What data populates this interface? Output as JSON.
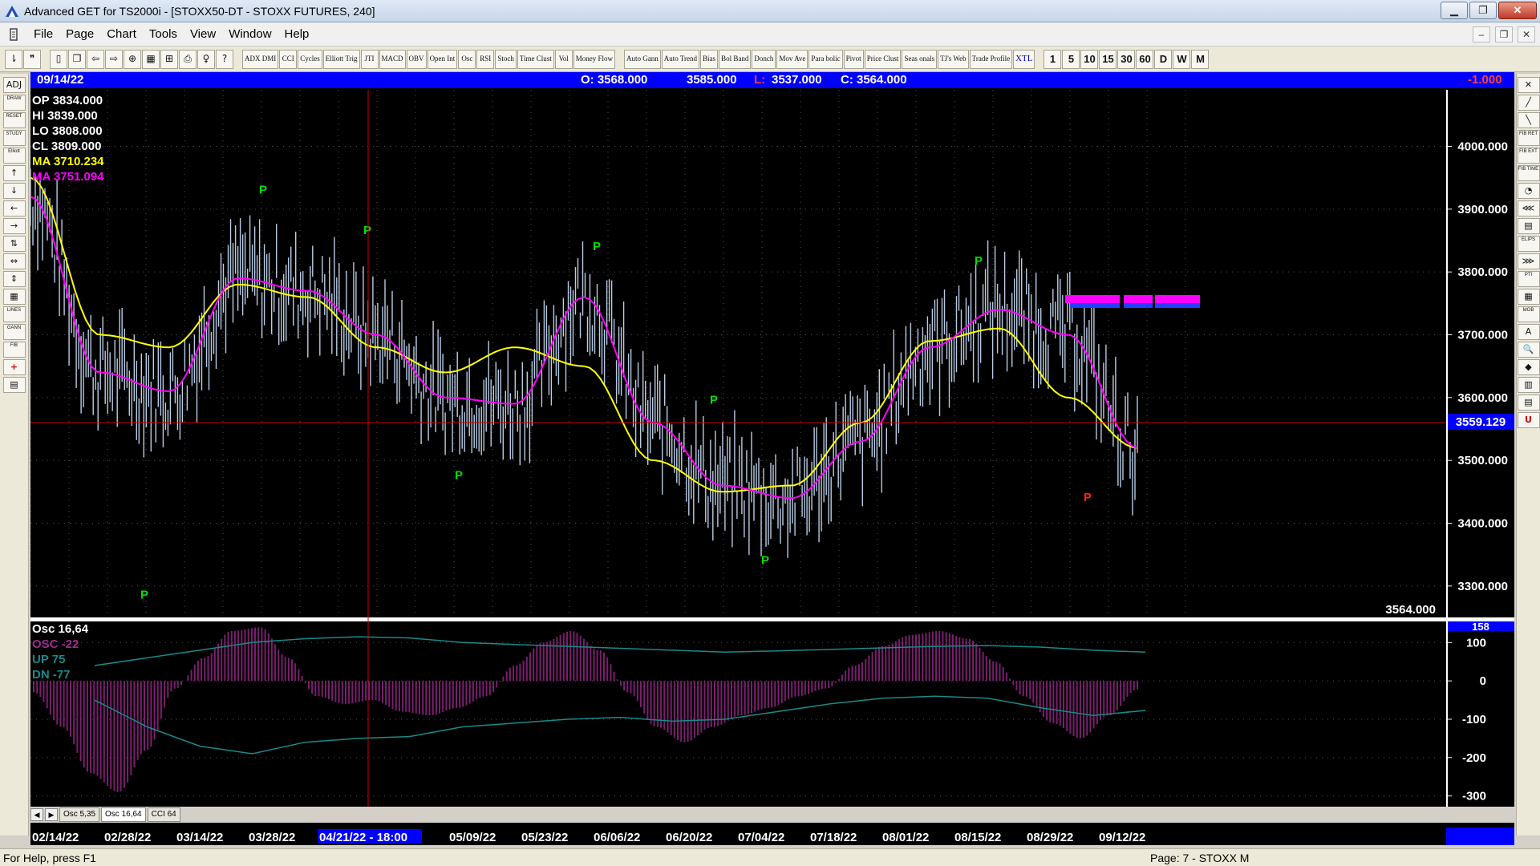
{
  "window": {
    "title": "Advanced GET for TS2000i - [STOXX50-DT - STOXX FUTURES, 240]",
    "minimize": "▁",
    "maximize": "❐",
    "close": "✕"
  },
  "menu": {
    "items": [
      "File",
      "Page",
      "Chart",
      "Tools",
      "View",
      "Window",
      "Help"
    ]
  },
  "mdi": {
    "minimize": "–",
    "restore": "❐",
    "close": "✕"
  },
  "toolbar": {
    "studies": [
      "ADX DMI",
      "CCI",
      "Cycles",
      "Elliott Trig",
      "JTI",
      "MACD",
      "OBV",
      "Open Int",
      "Osc",
      "RSI",
      "Stoch",
      "Time Clust",
      "Vol",
      "Money Flow"
    ],
    "studies2": [
      "Auto Gann",
      "Auto Trend",
      "Bias",
      "Bol Band",
      "Donch",
      "Mov Ave",
      "Para bolic",
      "Pivot",
      "Price Clust",
      "Seas onals",
      "TJ's Web",
      "Trade Profile",
      "XTL"
    ],
    "intervals": [
      "1",
      "5",
      "10",
      "15",
      "30",
      "60",
      "D",
      "W",
      "M"
    ]
  },
  "left_tools": [
    "ADJ",
    "DRAW",
    "RESET",
    "STUDY",
    "Elliott",
    "↑",
    "↓",
    "←",
    "→",
    "⇅",
    "⇔",
    "⇕",
    "▦",
    "LINES",
    "GANN",
    "FIB",
    "+",
    "▤"
  ],
  "right_tools": [
    "✕",
    "╱",
    "╲",
    "FIB RET",
    "FIB EXT",
    "FIB TIME",
    "◔",
    "⋘",
    "▤",
    "ELIPS",
    "⋙",
    "PTI",
    "▦",
    "MOB",
    "A",
    "🔍",
    "◆",
    "▥",
    "▤",
    "U"
  ],
  "info": {
    "date": "09/14/22",
    "open": "O: 3568.000",
    "high": "3585.000",
    "low_label": "L:",
    "low": "3537.000",
    "close": "C: 3564.000",
    "change": "-1.000"
  },
  "legend": {
    "op": "OP  3834.000",
    "hi": "HI   3839.000",
    "lo": "LO  3808.000",
    "cl": "CL  3809.000",
    "ma1": "MA  3710.234",
    "ma2": "MA  3751.094"
  },
  "price_labels": {
    "current": "3559.129",
    "last": "3564.000"
  },
  "osc_legend": {
    "title": "Osc 16,64",
    "osc": "OSC -22",
    "up": "UP   75",
    "dn": "DN   -77",
    "top_tag": "158"
  },
  "tabs": [
    "Osc 5,35",
    "Osc 16,64",
    "CCI 64"
  ],
  "dates": [
    "02/14/22",
    "02/28/22",
    "03/14/22",
    "03/28/22",
    "04/21/22 - 18:00",
    "05/09/22",
    "05/23/22",
    "06/06/22",
    "06/20/22",
    "07/04/22",
    "07/18/22",
    "08/01/22",
    "08/15/22",
    "08/29/22",
    "09/12/22"
  ],
  "status": {
    "left": "For Help, press F1",
    "right": "Page: 7 - STOXX M"
  },
  "colors": {
    "background": "#000000",
    "bars": "#b8cce4",
    "ma_yellow": "#ffff00",
    "ma_magenta": "#ff00ff",
    "pivot_green": "#00e000",
    "pivot_red": "#ff2020",
    "crosshair": "#cc0000",
    "osc_bars": "#7a1f6e",
    "osc_lines": "#1a8a8a",
    "info_bar": "#0000ff"
  },
  "chart_data": [
    {
      "type": "bar",
      "title": "STOXX50-DT - STOXX FUTURES, 240",
      "x": [
        "02/14/22",
        "02/28/22",
        "03/14/22",
        "03/28/22",
        "04/21/22 - 18:00",
        "05/09/22",
        "05/23/22",
        "06/06/22",
        "06/20/22",
        "07/04/22",
        "07/18/22",
        "08/01/22",
        "08/15/22",
        "08/29/22",
        "09/12/22"
      ],
      "y_ticks": [
        "4000.000",
        "3900.000",
        "3800.000",
        "3700.000",
        "3600.000",
        "3500.000",
        "3400.000",
        "3300.000"
      ],
      "ylim": [
        3250,
        4090
      ],
      "series": [
        {
          "name": "MA",
          "values": [
            3950,
            3700,
            3680,
            3780,
            3760,
            3680,
            3640,
            3680,
            3650,
            3500,
            3450,
            3460,
            3560,
            3690,
            3710,
            3600,
            3520
          ]
        },
        {
          "name": "MA",
          "values": [
            3920,
            3640,
            3610,
            3790,
            3770,
            3700,
            3600,
            3590,
            3760,
            3560,
            3460,
            3440,
            3530,
            3680,
            3740,
            3700,
            3520
          ]
        }
      ],
      "pivots": [
        {
          "label": "P",
          "price": 3925,
          "color": "green"
        },
        {
          "label": "P",
          "price": 3860,
          "color": "green"
        },
        {
          "label": "P",
          "price": 3835,
          "color": "green"
        },
        {
          "label": "P",
          "price": 3812,
          "color": "green"
        },
        {
          "label": "P",
          "price": 3590,
          "color": "green"
        },
        {
          "label": "P",
          "price": 3470,
          "color": "green"
        },
        {
          "label": "P",
          "price": 3335,
          "color": "green"
        },
        {
          "label": "P",
          "price": 3280,
          "color": "green"
        },
        {
          "label": "P",
          "price": 3435,
          "color": "red"
        }
      ]
    },
    {
      "type": "bar",
      "title": "Osc 16,64",
      "y_ticks": [
        "100",
        "0",
        "-100",
        "-200",
        "-300"
      ],
      "ylim": [
        -330,
        155
      ],
      "values": [
        -30,
        -120,
        -240,
        -290,
        -180,
        -20,
        60,
        130,
        140,
        60,
        -40,
        -60,
        -50,
        -80,
        -90,
        -70,
        -40,
        40,
        100,
        130,
        80,
        -30,
        -120,
        -160,
        -120,
        -90,
        -70,
        -40,
        -20,
        40,
        90,
        120,
        130,
        110,
        50,
        -40,
        -110,
        -150,
        -90,
        -22
      ]
    }
  ]
}
